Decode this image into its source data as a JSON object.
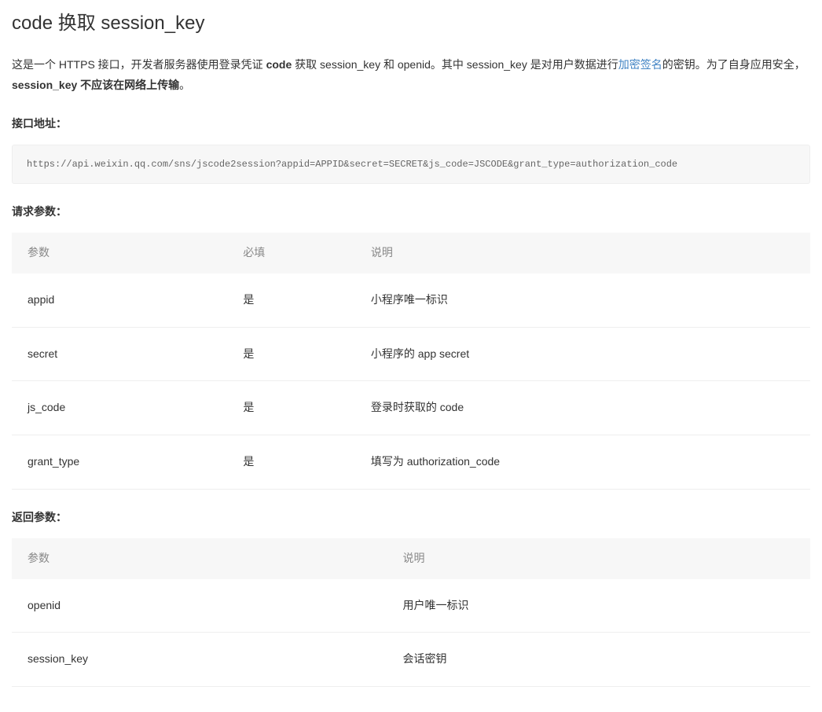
{
  "title": "code 换取 session_key",
  "intro": {
    "p1_prefix": " 这是一个 HTTPS 接口，开发者服务器使用登录凭证 ",
    "p1_bold1": "code",
    "p1_mid1": " 获取 session_key 和 openid。其中 session_key 是对用户数据进行",
    "p1_link": "加密签名",
    "p1_mid2": "的密钥。为了自身应用安全，",
    "p1_bold2": "session_key 不应该在网络上传输",
    "p1_suffix": "。"
  },
  "api_section_title": "接口地址：",
  "api_url": "https://api.weixin.qq.com/sns/jscode2session?appid=APPID&secret=SECRET&js_code=JSCODE&grant_type=authorization_code",
  "req_section_title": "请求参数：",
  "req_headers": {
    "param": "参数",
    "required": "必填",
    "desc": "说明"
  },
  "req_rows": [
    {
      "param": "appid",
      "required": "是",
      "desc": "小程序唯一标识"
    },
    {
      "param": "secret",
      "required": "是",
      "desc": "小程序的 app secret"
    },
    {
      "param": "js_code",
      "required": "是",
      "desc": "登录时获取的 code"
    },
    {
      "param": "grant_type",
      "required": "是",
      "desc": "填写为 authorization_code"
    }
  ],
  "ret_section_title": "返回参数：",
  "ret_headers": {
    "param": "参数",
    "desc": "说明"
  },
  "ret_rows": [
    {
      "param": "openid",
      "desc": "用户唯一标识"
    },
    {
      "param": "session_key",
      "desc": "会话密钥"
    }
  ]
}
